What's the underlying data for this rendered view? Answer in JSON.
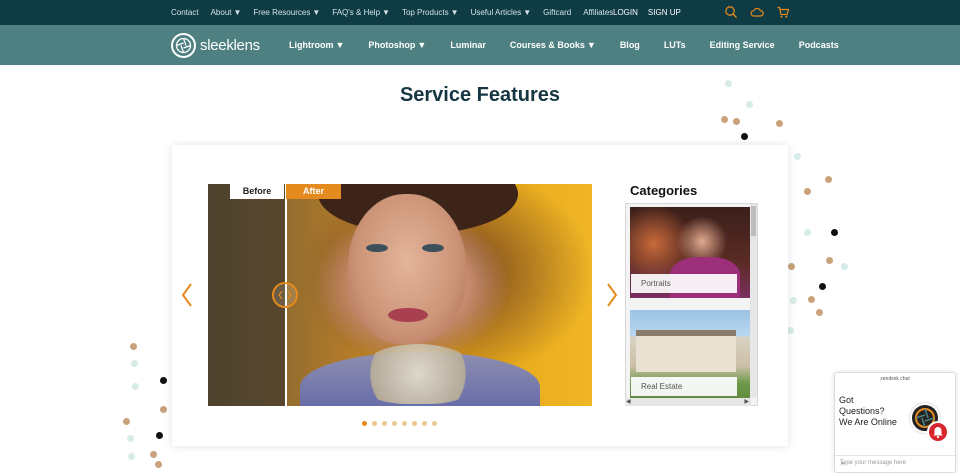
{
  "topbar": {
    "links": [
      {
        "label": "Contact",
        "has_menu": false
      },
      {
        "label": "About",
        "has_menu": true
      },
      {
        "label": "Free Resources",
        "has_menu": true
      },
      {
        "label": "FAQ's & Help",
        "has_menu": true
      },
      {
        "label": "Top Products",
        "has_menu": true
      },
      {
        "label": "Useful Articles",
        "has_menu": true
      },
      {
        "label": "Giftcard",
        "has_menu": false
      },
      {
        "label": "Affiliates",
        "has_menu": false
      }
    ],
    "login_label": "LOGIN",
    "signup_label": "SIGN UP",
    "icons": [
      "search-icon",
      "cloud-icon",
      "cart-icon"
    ]
  },
  "mainnav": {
    "logo_text": "sleeklens",
    "links": [
      {
        "label": "Lightroom",
        "has_menu": true
      },
      {
        "label": "Photoshop",
        "has_menu": true
      },
      {
        "label": "Luminar",
        "has_menu": false
      },
      {
        "label": "Courses & Books",
        "has_menu": true
      },
      {
        "label": "Blog",
        "has_menu": false
      },
      {
        "label": "LUTs",
        "has_menu": false
      },
      {
        "label": "Editing Service",
        "has_menu": false
      },
      {
        "label": "Podcasts",
        "has_menu": false
      }
    ]
  },
  "page": {
    "title": "Service Features"
  },
  "slider": {
    "before_label": "Before",
    "after_label": "After",
    "pages": 8,
    "active_page": 0
  },
  "categories": {
    "title": "Categories",
    "items": [
      {
        "label": "Portraits"
      },
      {
        "label": "Real Estate"
      }
    ]
  },
  "chat": {
    "header": "zendesk chat",
    "message": "Got Questions? We Are Online",
    "input_placeholder": "Type your message here"
  },
  "colors": {
    "topbar_bg": "#0f3b45",
    "nav_bg": "#4e8081",
    "accent_orange": "#e58a1e",
    "title_color": "#163642"
  }
}
